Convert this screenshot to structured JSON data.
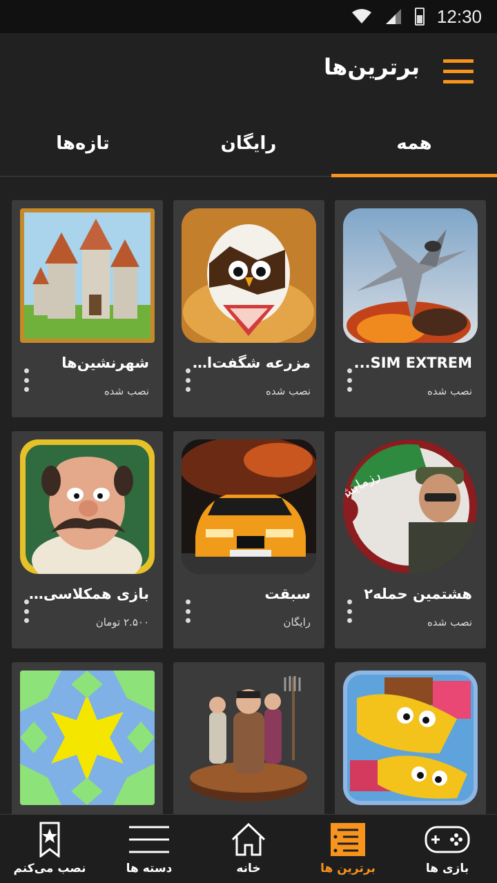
{
  "status_bar": {
    "time": "12:30"
  },
  "app_bar": {
    "title": "برترین‌ها"
  },
  "tabs": [
    {
      "label": "همه",
      "active": true
    },
    {
      "label": "رایگان",
      "active": false
    },
    {
      "label": "تازه‌ها",
      "active": false
    }
  ],
  "apps": [
    {
      "title": "SIM EXTREM...",
      "subtitle": "نصب شده",
      "icon": "jet-fighter-image"
    },
    {
      "title": "مزرعه شگفت‌انـ...",
      "subtitle": "نصب شده",
      "icon": "egg-chick-image"
    },
    {
      "title": "شهرنشین‌ها",
      "subtitle": "نصب شده",
      "icon": "castle-image"
    },
    {
      "title": "هشتمین حمله۲",
      "subtitle": "نصب شده",
      "icon": "soldier-image"
    },
    {
      "title": "سبقت",
      "subtitle": "رایگان",
      "icon": "sports-car-image"
    },
    {
      "title": "بازی همکلاسی‌ها",
      "subtitle": "۲.۵۰۰ تومان",
      "icon": "teacher-cartoon-image"
    },
    {
      "title": "",
      "subtitle": "",
      "icon": "candy-faces-image"
    },
    {
      "title": "",
      "subtitle": "",
      "icon": "villagers-image"
    },
    {
      "title": "",
      "subtitle": "",
      "icon": "star-pattern-image"
    }
  ],
  "badge_text": "رزمایش",
  "bottom_nav": [
    {
      "label": "بازی ها",
      "icon": "gamepad-icon",
      "active": false
    },
    {
      "label": "برترین ها",
      "icon": "ranking-list-icon",
      "active": true
    },
    {
      "label": "خانه",
      "icon": "home-icon",
      "active": false
    },
    {
      "label": "دسته ها",
      "icon": "menu-lines-icon",
      "active": false
    },
    {
      "label": "نصب می‌کنم",
      "icon": "bookmark-star-icon",
      "active": false
    }
  ],
  "colors": {
    "accent": "#f7941d",
    "background": "#212121",
    "card": "#3b3b3b"
  }
}
